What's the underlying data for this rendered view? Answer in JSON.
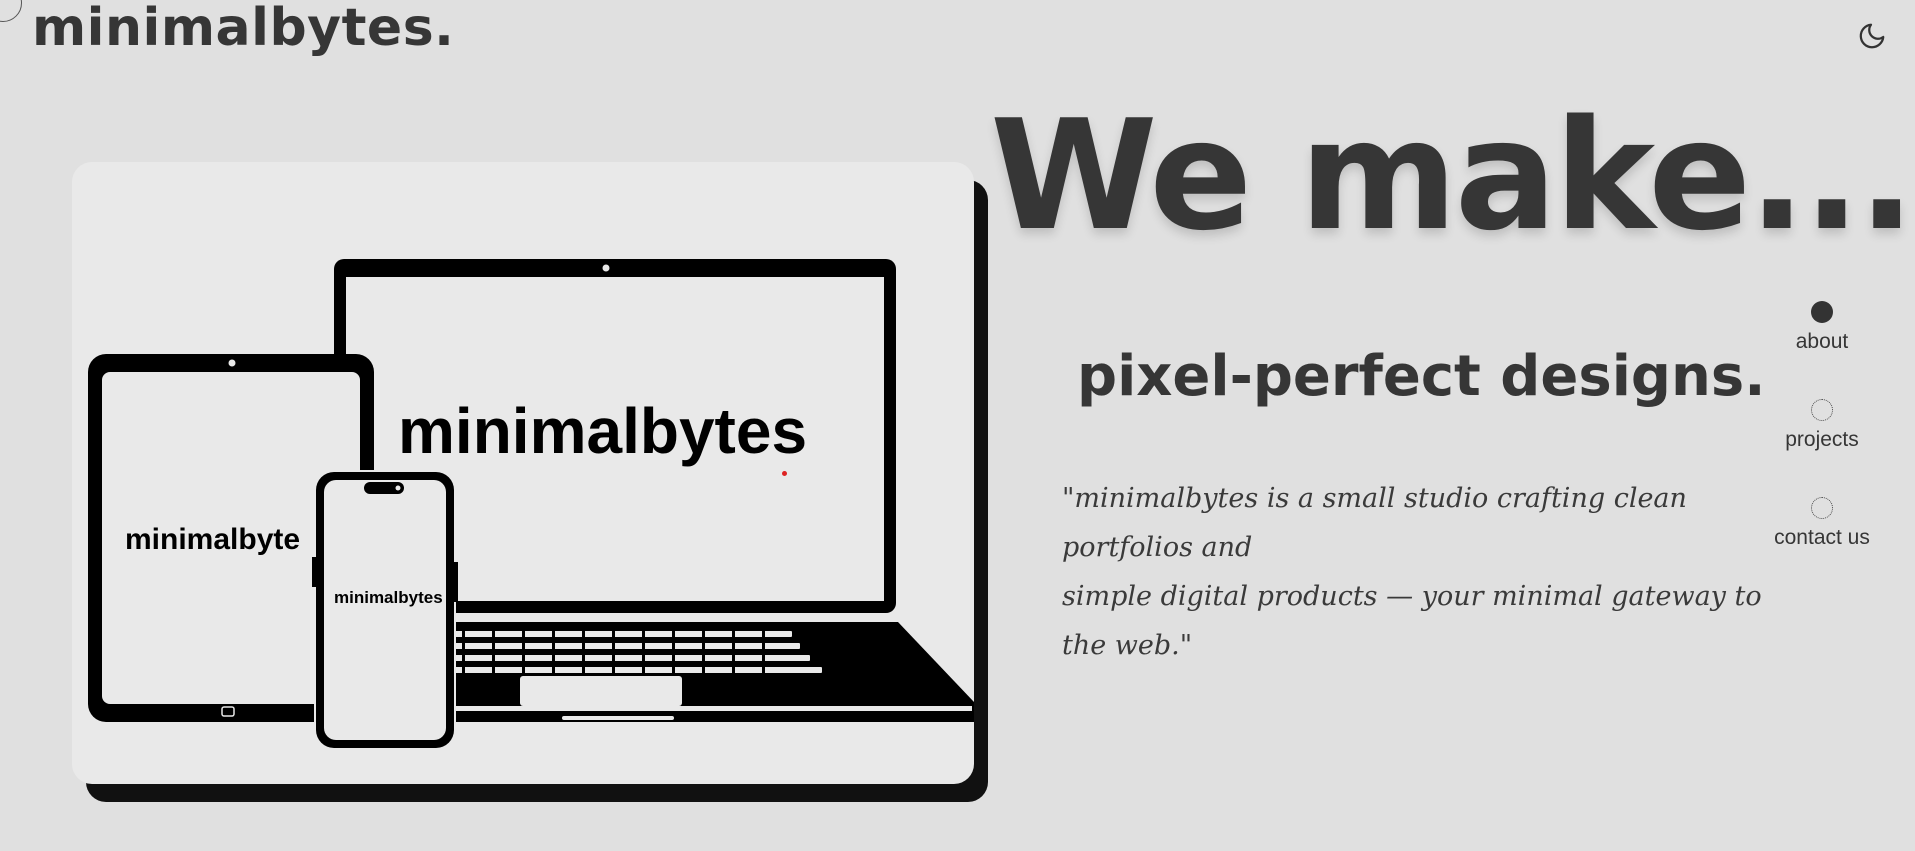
{
  "brand": {
    "logo": "minimalbytes."
  },
  "header": {
    "theme_toggle_icon": "moon-icon"
  },
  "hero": {
    "title": "We make...",
    "subtitle": "pixel-perfect designs.",
    "quote_line1": "\"minimalbytes is a small studio crafting clean portfolios and",
    "quote_line2": "simple digital products — your minimal gateway to the web.\""
  },
  "illustration": {
    "laptop_text": "minimalbytes",
    "tablet_text": "minimalbyte",
    "phone_text": "minimalbytes"
  },
  "nav": {
    "items": [
      {
        "label": "about",
        "active": true
      },
      {
        "label": "projects",
        "active": false
      },
      {
        "label": "contact us",
        "active": false
      }
    ]
  },
  "colors": {
    "background": "#e0e0e0",
    "text": "#363636",
    "card": "#e9e9e9",
    "accent_dot": "#dd2222"
  }
}
